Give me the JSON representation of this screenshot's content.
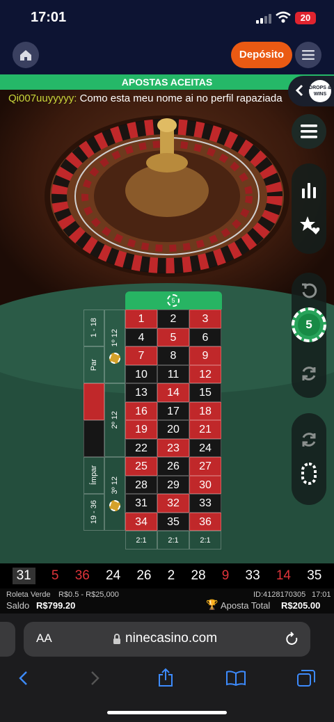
{
  "status_bar": {
    "time": "17:01",
    "battery": "20"
  },
  "header": {
    "deposit_label": "Depósito"
  },
  "game": {
    "banner": "APOSTAS ACEITAS",
    "chat": {
      "user": "Qi007uuyyyyy:",
      "message": "Como esta meu nome ai no perfil rapaziada"
    },
    "drops_logo": "DROPS & WINS",
    "chip_value": "5",
    "zero_chip": "5",
    "board_rows": [
      [
        {
          "n": "1",
          "c": "red"
        },
        {
          "n": "2",
          "c": "black"
        },
        {
          "n": "3",
          "c": "red"
        }
      ],
      [
        {
          "n": "4",
          "c": "black"
        },
        {
          "n": "5",
          "c": "red"
        },
        {
          "n": "6",
          "c": "black"
        }
      ],
      [
        {
          "n": "7",
          "c": "red"
        },
        {
          "n": "8",
          "c": "black"
        },
        {
          "n": "9",
          "c": "red"
        }
      ],
      [
        {
          "n": "10",
          "c": "black"
        },
        {
          "n": "11",
          "c": "black"
        },
        {
          "n": "12",
          "c": "red"
        }
      ],
      [
        {
          "n": "13",
          "c": "black"
        },
        {
          "n": "14",
          "c": "red"
        },
        {
          "n": "15",
          "c": "black"
        }
      ],
      [
        {
          "n": "16",
          "c": "red"
        },
        {
          "n": "17",
          "c": "black"
        },
        {
          "n": "18",
          "c": "red"
        }
      ],
      [
        {
          "n": "19",
          "c": "red"
        },
        {
          "n": "20",
          "c": "black"
        },
        {
          "n": "21",
          "c": "red"
        }
      ],
      [
        {
          "n": "22",
          "c": "black"
        },
        {
          "n": "23",
          "c": "red"
        },
        {
          "n": "24",
          "c": "black"
        }
      ],
      [
        {
          "n": "25",
          "c": "red"
        },
        {
          "n": "26",
          "c": "black"
        },
        {
          "n": "27",
          "c": "red"
        }
      ],
      [
        {
          "n": "28",
          "c": "black"
        },
        {
          "n": "29",
          "c": "black"
        },
        {
          "n": "30",
          "c": "red"
        }
      ],
      [
        {
          "n": "31",
          "c": "black"
        },
        {
          "n": "32",
          "c": "red"
        },
        {
          "n": "33",
          "c": "black"
        }
      ],
      [
        {
          "n": "34",
          "c": "red"
        },
        {
          "n": "35",
          "c": "black"
        },
        {
          "n": "36",
          "c": "red"
        }
      ]
    ],
    "column_bets": [
      "2:1",
      "2:1",
      "2:1"
    ],
    "outside": {
      "low": "1 - 18",
      "even": "Par",
      "odd": "Ímpar",
      "high": "19 - 36",
      "dozen1": "1º 12",
      "dozen2": "2º 12",
      "dozen3": "3º 12"
    },
    "history": [
      {
        "n": "31",
        "c": "#ffffff"
      },
      {
        "n": "5",
        "c": "#e0343a"
      },
      {
        "n": "36",
        "c": "#e0343a"
      },
      {
        "n": "24",
        "c": "#ffffff"
      },
      {
        "n": "26",
        "c": "#ffffff"
      },
      {
        "n": "2",
        "c": "#ffffff"
      },
      {
        "n": "28",
        "c": "#ffffff"
      },
      {
        "n": "9",
        "c": "#e0343a"
      },
      {
        "n": "33",
        "c": "#ffffff"
      },
      {
        "n": "14",
        "c": "#e0343a"
      },
      {
        "n": "35",
        "c": "#ffffff"
      }
    ],
    "info": {
      "table_name": "Roleta Verde",
      "limits": "R$0.5 - R$25,000",
      "round_id": "ID:4128170305",
      "round_time": "17:01",
      "balance_label": "Saldo",
      "balance_value": "R$799.20",
      "total_bet_label": "Aposta Total",
      "total_bet_value": "R$205.00"
    }
  },
  "browser": {
    "text_size": "AA",
    "url": "ninecasino.com"
  },
  "colors": {
    "red": "#c0282a",
    "black": "#161616",
    "green": "#27b463",
    "accent": "#ea5a13"
  }
}
